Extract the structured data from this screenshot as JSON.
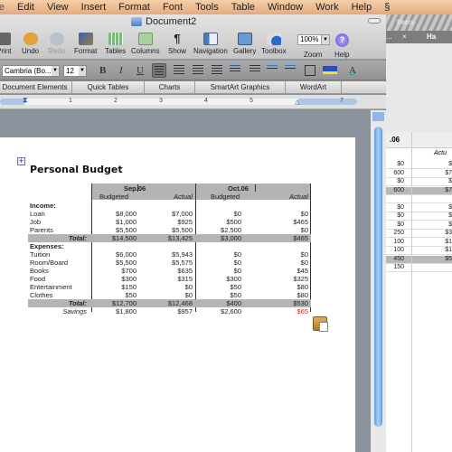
{
  "menubar": {
    "items": [
      "ile",
      "Edit",
      "View",
      "Insert",
      "Format",
      "Font",
      "Tools",
      "Table",
      "Window",
      "Work",
      "Help"
    ]
  },
  "background_window": {
    "title_fragment": "Items",
    "tab_left": "...",
    "tab_close": "×",
    "tab_right": "Ha",
    "header_fragment": ".06",
    "header_actual": "Actu",
    "rows": [
      {
        "c1": "$0",
        "c2": "$",
        "shade": false
      },
      {
        "c1": "600",
        "c2": "$7",
        "shade": false
      },
      {
        "c1": "$0",
        "c2": "$",
        "shade": false
      },
      {
        "c1": "600",
        "c2": "$7",
        "shade": true
      },
      {
        "c1": "",
        "c2": "",
        "shade": false
      },
      {
        "c1": "$0",
        "c2": "$",
        "shade": false
      },
      {
        "c1": "$0",
        "c2": "$",
        "shade": false
      },
      {
        "c1": "$0",
        "c2": "$",
        "shade": false
      },
      {
        "c1": "250",
        "c2": "$3",
        "shade": false
      },
      {
        "c1": "100",
        "c2": "$1",
        "shade": false
      },
      {
        "c1": "100",
        "c2": "$1",
        "shade": false
      },
      {
        "c1": "450",
        "c2": "$5",
        "shade": true
      },
      {
        "c1": "150",
        "c2": "",
        "shade": false
      }
    ]
  },
  "window": {
    "title": "Document2",
    "toolbar": [
      {
        "label": "Print",
        "icon": "printer-icon",
        "disabled": false
      },
      {
        "label": "Undo",
        "icon": "undo-icon",
        "disabled": false
      },
      {
        "label": "Redo",
        "icon": "redo-icon",
        "disabled": true
      },
      {
        "label": "Format",
        "icon": "format-brush-icon",
        "disabled": false
      },
      {
        "label": "Tables",
        "icon": "table-icon",
        "disabled": false
      },
      {
        "label": "Columns",
        "icon": "columns-icon",
        "disabled": false
      },
      {
        "label": "Show",
        "icon": "pilcrow-icon",
        "disabled": false
      },
      {
        "label": "Navigation",
        "icon": "navigation-pane-icon",
        "disabled": false
      },
      {
        "label": "Gallery",
        "icon": "gallery-icon",
        "disabled": false
      },
      {
        "label": "Toolbox",
        "icon": "toolbox-icon",
        "disabled": false
      }
    ],
    "zoom": {
      "value": "100%",
      "label": "Zoom"
    },
    "help": {
      "label": "Help",
      "glyph": "?"
    }
  },
  "formatting": {
    "font": "Cambria (Bo...",
    "size": "12",
    "bold": "B",
    "italic": "I",
    "underline": "U"
  },
  "ribbon": {
    "tabs": [
      "Document Elements",
      "Quick Tables",
      "Charts",
      "SmartArt Graphics",
      "WordArt"
    ]
  },
  "ruler": {
    "numbers": [
      "1",
      "2",
      "3",
      "4",
      "5",
      "7"
    ]
  },
  "document": {
    "title": "Personal Budget",
    "periods": [
      {
        "name": "Sep.06",
        "budgeted_label": "Budgeted",
        "actual_label": "Actual"
      },
      {
        "name": "Oct.06",
        "budgeted_label": "Budgeted",
        "actual_label": "Actual"
      }
    ],
    "rows": [
      {
        "label": "Income:",
        "type": "section",
        "values": [
          "",
          "",
          "",
          ""
        ]
      },
      {
        "label": "Loan",
        "type": "item",
        "values": [
          "$8,000",
          "$7,000",
          "$0",
          "$0"
        ]
      },
      {
        "label": "Job",
        "type": "item",
        "values": [
          "$1,000",
          "$925",
          "$500",
          "$465"
        ]
      },
      {
        "label": "Parents",
        "type": "item",
        "values": [
          "$5,500",
          "$5,500",
          "$2,500",
          "$0"
        ]
      },
      {
        "label": "Total:",
        "type": "total",
        "values": [
          "$14,500",
          "$13,425",
          "$3,000",
          "$465"
        ]
      },
      {
        "label": "Expenses:",
        "type": "section",
        "values": [
          "",
          "",
          "",
          ""
        ]
      },
      {
        "label": "Tuition",
        "type": "item",
        "values": [
          "$6,000",
          "$5,943",
          "$0",
          "$0"
        ]
      },
      {
        "label": "Room/Board",
        "type": "item",
        "values": [
          "$5,500",
          "$5,575",
          "$0",
          "$0"
        ]
      },
      {
        "label": "Books",
        "type": "item",
        "values": [
          "$700",
          "$635",
          "$0",
          "$45"
        ]
      },
      {
        "label": "Food",
        "type": "item",
        "values": [
          "$300",
          "$315",
          "$300",
          "$325"
        ]
      },
      {
        "label": "Entertainment",
        "type": "item",
        "values": [
          "$150",
          "$0",
          "$50",
          "$80"
        ]
      },
      {
        "label": "Clothes",
        "type": "item",
        "values": [
          "$50",
          "$0",
          "$50",
          "$80"
        ]
      },
      {
        "label": "Total:",
        "type": "total",
        "values": [
          "$12,700",
          "$12,468",
          "$400",
          "$530"
        ]
      },
      {
        "label": "Savings",
        "type": "savings",
        "values": [
          "$1,800",
          "$957",
          "$2,600",
          "$65"
        ]
      }
    ],
    "negative_color": "#e02020"
  }
}
